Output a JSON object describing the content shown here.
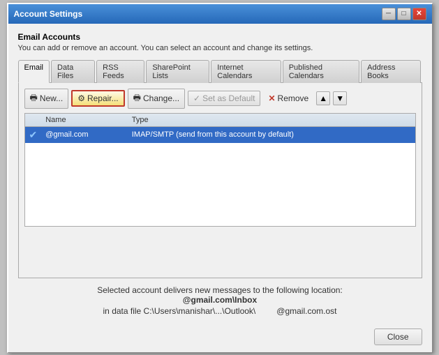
{
  "window": {
    "title": "Account Settings",
    "close_btn_label": "✕"
  },
  "header": {
    "title": "Email Accounts",
    "description": "You can add or remove an account. You can select an account and change its settings."
  },
  "tabs": [
    {
      "id": "email",
      "label": "Email",
      "active": true
    },
    {
      "id": "data-files",
      "label": "Data Files",
      "active": false
    },
    {
      "id": "rss-feeds",
      "label": "RSS Feeds",
      "active": false
    },
    {
      "id": "sharepoint",
      "label": "SharePoint Lists",
      "active": false
    },
    {
      "id": "internet-cal",
      "label": "Internet Calendars",
      "active": false
    },
    {
      "id": "published-cal",
      "label": "Published Calendars",
      "active": false
    },
    {
      "id": "address-books",
      "label": "Address Books",
      "active": false
    }
  ],
  "toolbar": {
    "new_label": "New...",
    "repair_label": "Repair...",
    "change_label": "Change...",
    "set_default_label": "Set as Default",
    "remove_label": "Remove",
    "up_icon": "▲",
    "down_icon": "▼"
  },
  "table": {
    "col_name": "Name",
    "col_type": "Type",
    "rows": [
      {
        "check": "✔",
        "name": "@gmail.com",
        "type": "IMAP/SMTP (send from this account by default)",
        "selected": true
      }
    ]
  },
  "footer": {
    "line1": "Selected account delivers new messages to the following location:",
    "location": "@gmail.com\\Inbox",
    "path_label": "in data file C:\\Users\\manishar\\...\\Outlook\\",
    "ost_label": "@gmail.com.ost"
  },
  "buttons": {
    "close_label": "Close"
  },
  "icons": {
    "new_icon": "🖶",
    "repair_icon": "⚙",
    "change_icon": "🖶",
    "remove_icon": "✕"
  }
}
